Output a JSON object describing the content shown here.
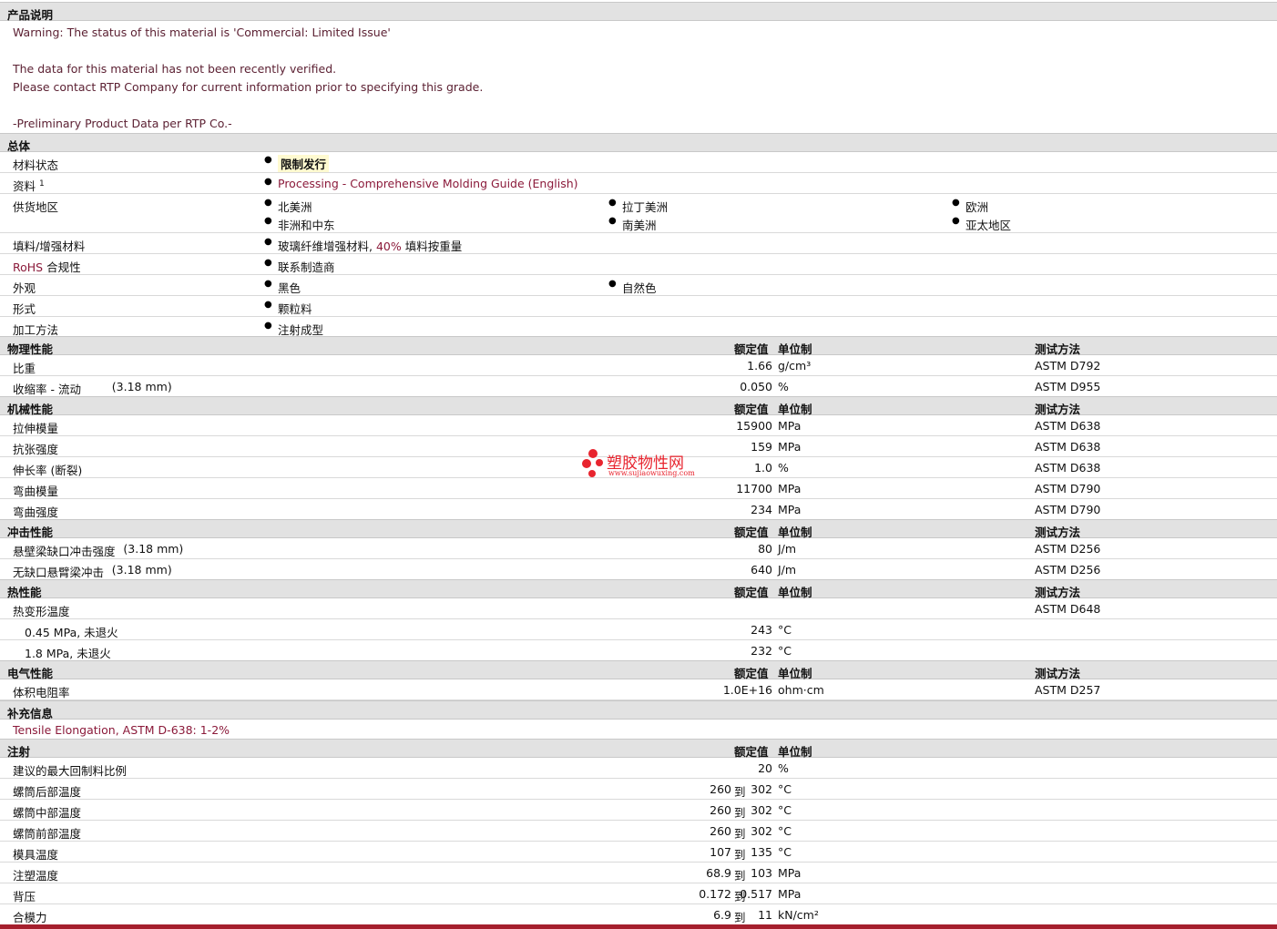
{
  "desc": {
    "title": "产品说明",
    "warning": "Warning: The status of this material is 'Commercial: Limited Issue'",
    "line1": "The data for this material has not been recently verified.",
    "line2": "Please contact RTP Company for current information prior to specifying this grade.",
    "line3": "-Preliminary Product Data per RTP Co.-"
  },
  "general": {
    "title": "总体",
    "status_label": "材料状态",
    "status_value": "限制发行",
    "docs_label": "资料",
    "docs_sup": "1",
    "docs_value": "Processing - Comprehensive Molding Guide (English)",
    "regions_label": "供货地区",
    "regions": [
      "北美洲",
      "拉丁美洲",
      "欧洲",
      "非洲和中东",
      "南美洲",
      "亚太地区"
    ],
    "filler_label": "填料/增强材料",
    "filler_pre": "玻璃纤维增强材料,",
    "filler_pct": "40%",
    "filler_post": "填料按重量",
    "rohs_label_a": "RoHS",
    "rohs_label_b": "合规性",
    "rohs_value": "联系制造商",
    "appearance_label": "外观",
    "appearance": [
      "黑色",
      "自然色"
    ],
    "form_label": "形式",
    "form_value": "颗粒料",
    "method_label": "加工方法",
    "method_value": "注射成型"
  },
  "headers": {
    "nominal": "额定值",
    "unit": "单位制",
    "test": "测试方法"
  },
  "physical": {
    "title": "物理性能",
    "rows": [
      {
        "name": "比重",
        "cond": "",
        "value": "1.66",
        "unit": "g/cm³",
        "test": "ASTM D792"
      },
      {
        "name": "收缩率 - 流动",
        "cond": "(3.18 mm)",
        "value": "0.050",
        "unit": "%",
        "test": "ASTM D955"
      }
    ]
  },
  "mechanical": {
    "title": "机械性能",
    "rows": [
      {
        "name": "拉伸模量",
        "cond": "",
        "value": "15900",
        "unit": "MPa",
        "test": "ASTM D638"
      },
      {
        "name": "抗张强度",
        "cond": "",
        "value": "159",
        "unit": "MPa",
        "test": "ASTM D638"
      },
      {
        "name": "伸长率 (断裂)",
        "cond": "",
        "value": "1.0",
        "unit": "%",
        "test": "ASTM D638"
      },
      {
        "name": "弯曲模量",
        "cond": "",
        "value": "11700",
        "unit": "MPa",
        "test": "ASTM D790"
      },
      {
        "name": "弯曲强度",
        "cond": "",
        "value": "234",
        "unit": "MPa",
        "test": "ASTM D790"
      }
    ]
  },
  "impact": {
    "title": "冲击性能",
    "rows": [
      {
        "name": "悬壁梁缺口冲击强度",
        "cond": "(3.18 mm)",
        "value": "80",
        "unit": "J/m",
        "test": "ASTM D256"
      },
      {
        "name": "无缺口悬臂梁冲击",
        "cond": "(3.18 mm)",
        "value": "640",
        "unit": "J/m",
        "test": "ASTM D256"
      }
    ]
  },
  "thermal": {
    "title": "热性能",
    "hdt_name": "热变形温度",
    "hdt_test": "ASTM D648",
    "rows": [
      {
        "name": "0.45 MPa, 未退火",
        "value": "243",
        "unit": "°C"
      },
      {
        "name": "1.8 MPa, 未退火",
        "value": "232",
        "unit": "°C"
      }
    ]
  },
  "electrical": {
    "title": "电气性能",
    "rows": [
      {
        "name": "体积电阻率",
        "value": "1.0E+16",
        "unit": "ohm·cm",
        "test": "ASTM D257"
      }
    ]
  },
  "supplement": {
    "title": "补充信息",
    "text": "Tensile Elongation, ASTM D-638: 1-2%"
  },
  "injection": {
    "title": "注射",
    "to": "到",
    "rows": [
      {
        "name": "建议的最大回制料比例",
        "lo": "",
        "hi": "20",
        "unit": "%"
      },
      {
        "name": "螺筒后部温度",
        "lo": "260",
        "hi": "302",
        "unit": "°C"
      },
      {
        "name": "螺筒中部温度",
        "lo": "260",
        "hi": "302",
        "unit": "°C"
      },
      {
        "name": "螺筒前部温度",
        "lo": "260",
        "hi": "302",
        "unit": "°C"
      },
      {
        "name": "模具温度",
        "lo": "107",
        "hi": "135",
        "unit": "°C"
      },
      {
        "name": "注塑温度",
        "lo": "68.9",
        "hi": "103",
        "unit": "MPa"
      },
      {
        "name": "背压",
        "lo": "0.172",
        "hi": "0.517",
        "unit": "MPa"
      },
      {
        "name": "合模力",
        "lo": "6.9",
        "hi": "11",
        "unit": "kN/cm²"
      }
    ]
  },
  "watermark": {
    "cn": "塑胶物性网",
    "url": "www.sujiaowuxing.com",
    "accent": "#e8242e"
  }
}
